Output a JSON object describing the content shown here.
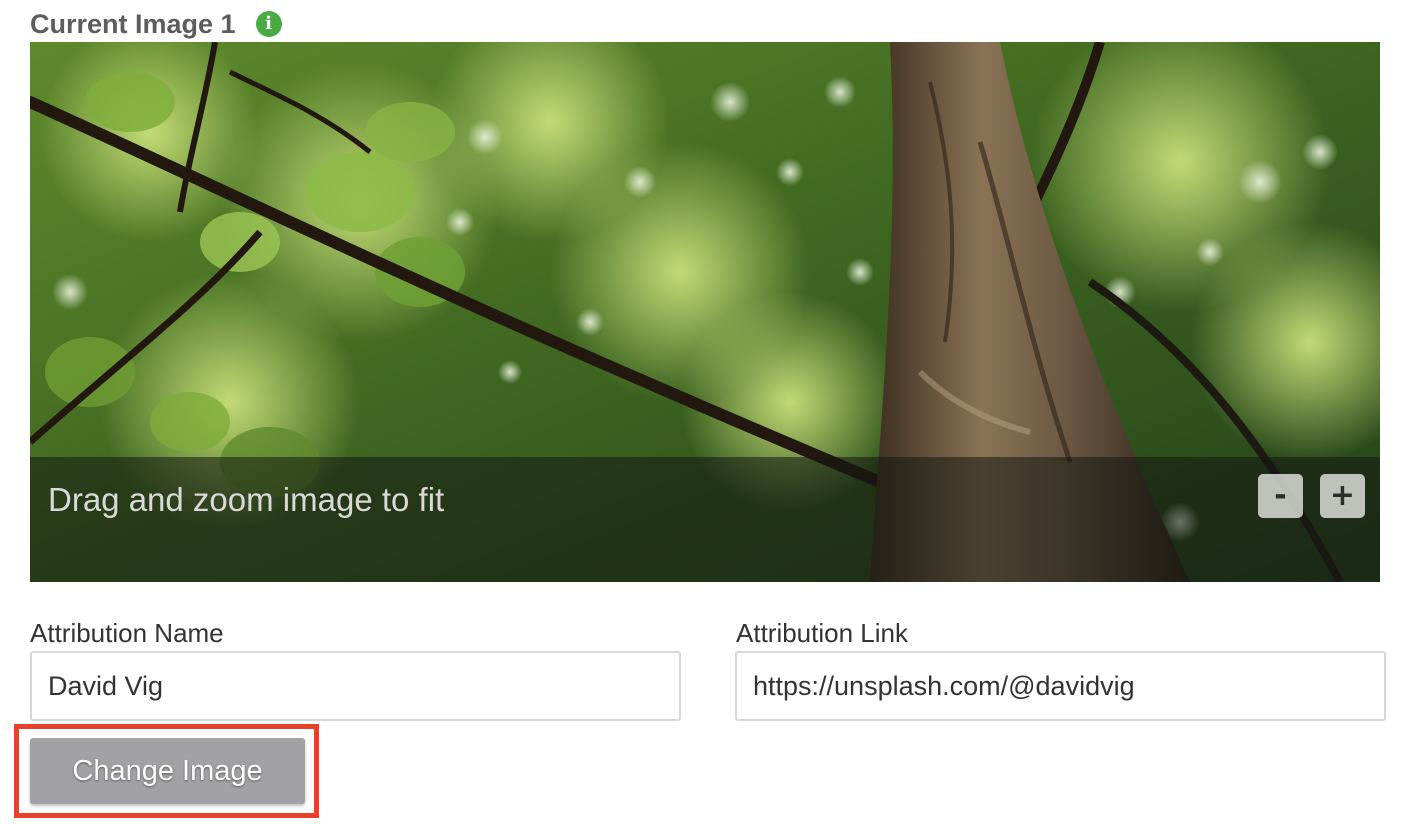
{
  "section": {
    "title": "Current Image 1",
    "info_icon": "info-icon",
    "info_icon_glyph": "i",
    "info_icon_color": "#4caa42"
  },
  "image_editor": {
    "hint": "Drag and zoom image to fit",
    "zoom_out_label": "-",
    "zoom_in_label": "+"
  },
  "fields": {
    "attribution_name": {
      "label": "Attribution Name",
      "value": "David Vig"
    },
    "attribution_link": {
      "label": "Attribution Link",
      "value": "https://unsplash.com/@davidvig"
    }
  },
  "actions": {
    "change_image_label": "Change Image",
    "highlight_color": "#e8412a"
  }
}
